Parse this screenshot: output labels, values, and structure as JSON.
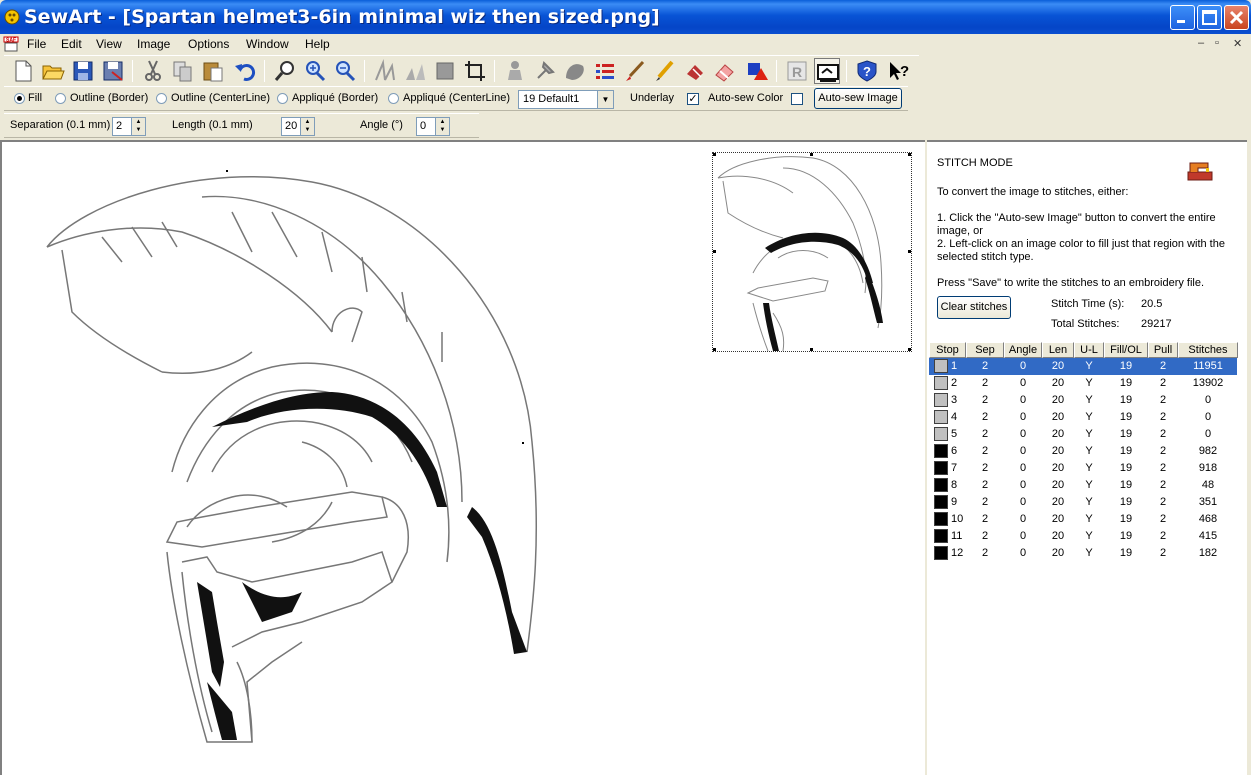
{
  "window": {
    "title": "SewArt - [Spartan helmet3-6in minimal wiz then sized.png]"
  },
  "menu": [
    "File",
    "Edit",
    "View",
    "Image",
    "Options",
    "Window",
    "Help"
  ],
  "icons": {
    "toolbar": [
      "new-file-icon",
      "open-folder-icon",
      "save-icon",
      "save-as-icon",
      "cut-icon",
      "copy-icon",
      "paste-icon",
      "undo-icon",
      "zoom-icon",
      "zoom-in-icon",
      "zoom-out-icon",
      "merge-icon",
      "split-icon",
      "fill-icon",
      "crop-icon",
      "figure-icon",
      "pin-icon",
      "blob-icon",
      "stripes-icon",
      "brush-icon",
      "pencil-icon",
      "eraser-fill-icon",
      "eraser-icon",
      "shapes-icon",
      "r-icon",
      "auto-sew-icon",
      "help-icon",
      "context-help-icon"
    ]
  },
  "options": {
    "fill": "Fill",
    "outline_border": "Outline (Border)",
    "outline_centerline": "Outline (CenterLine)",
    "applique_border": "Appliqué (Border)",
    "applique_centerline": "Appliqué (CenterLine)",
    "preset": "19 Default1",
    "underlay": "Underlay",
    "autosew_color": "Auto-sew Color",
    "autosew_image": "Auto-sew Image",
    "separation_label": "Separation (0.1 mm)",
    "separation_value": "2",
    "length_label": "Length (0.1 mm)",
    "length_value": "20",
    "angle_label": "Angle (°)",
    "angle_value": "0"
  },
  "panel": {
    "heading": "STITCH MODE",
    "line1": "To convert the image to stitches, either:",
    "line2": "1. Click the \"Auto-sew Image\" button to convert the entire image, or",
    "line3": "2. Left-click on an image color to fill just that region with the selected stitch type.",
    "line4": "Press \"Save\" to write the stitches to an embroidery file.",
    "clear_btn": "Clear stitches",
    "stitch_time_label": "Stitch Time (s):",
    "stitch_time": "20.5",
    "total_label": "Total Stitches:",
    "total": "29217"
  },
  "table": {
    "headers": [
      "Stop",
      "Sep",
      "Angle",
      "Len",
      "U-L",
      "Fill/OL",
      "Pull",
      "Stitches"
    ],
    "rows": [
      {
        "stop": "1",
        "sep": "2",
        "angle": "0",
        "len": "20",
        "ul": "Y",
        "fill": "19",
        "pull": "2",
        "stitches": "11951",
        "color": "#c0c0c0"
      },
      {
        "stop": "2",
        "sep": "2",
        "angle": "0",
        "len": "20",
        "ul": "Y",
        "fill": "19",
        "pull": "2",
        "stitches": "13902",
        "color": "#c0c0c0"
      },
      {
        "stop": "3",
        "sep": "2",
        "angle": "0",
        "len": "20",
        "ul": "Y",
        "fill": "19",
        "pull": "2",
        "stitches": "0",
        "color": "#c0c0c0"
      },
      {
        "stop": "4",
        "sep": "2",
        "angle": "0",
        "len": "20",
        "ul": "Y",
        "fill": "19",
        "pull": "2",
        "stitches": "0",
        "color": "#c0c0c0"
      },
      {
        "stop": "5",
        "sep": "2",
        "angle": "0",
        "len": "20",
        "ul": "Y",
        "fill": "19",
        "pull": "2",
        "stitches": "0",
        "color": "#c0c0c0"
      },
      {
        "stop": "6",
        "sep": "2",
        "angle": "0",
        "len": "20",
        "ul": "Y",
        "fill": "19",
        "pull": "2",
        "stitches": "982",
        "color": "#000000"
      },
      {
        "stop": "7",
        "sep": "2",
        "angle": "0",
        "len": "20",
        "ul": "Y",
        "fill": "19",
        "pull": "2",
        "stitches": "918",
        "color": "#000000"
      },
      {
        "stop": "8",
        "sep": "2",
        "angle": "0",
        "len": "20",
        "ul": "Y",
        "fill": "19",
        "pull": "2",
        "stitches": "48",
        "color": "#000000"
      },
      {
        "stop": "9",
        "sep": "2",
        "angle": "0",
        "len": "20",
        "ul": "Y",
        "fill": "19",
        "pull": "2",
        "stitches": "351",
        "color": "#000000"
      },
      {
        "stop": "10",
        "sep": "2",
        "angle": "0",
        "len": "20",
        "ul": "Y",
        "fill": "19",
        "pull": "2",
        "stitches": "468",
        "color": "#000000"
      },
      {
        "stop": "11",
        "sep": "2",
        "angle": "0",
        "len": "20",
        "ul": "Y",
        "fill": "19",
        "pull": "2",
        "stitches": "415",
        "color": "#000000"
      },
      {
        "stop": "12",
        "sep": "2",
        "angle": "0",
        "len": "20",
        "ul": "Y",
        "fill": "19",
        "pull": "2",
        "stitches": "182",
        "color": "#000000"
      }
    ]
  },
  "colors": {
    "selection": "#316ac5",
    "title_bar": "#0854d6"
  }
}
